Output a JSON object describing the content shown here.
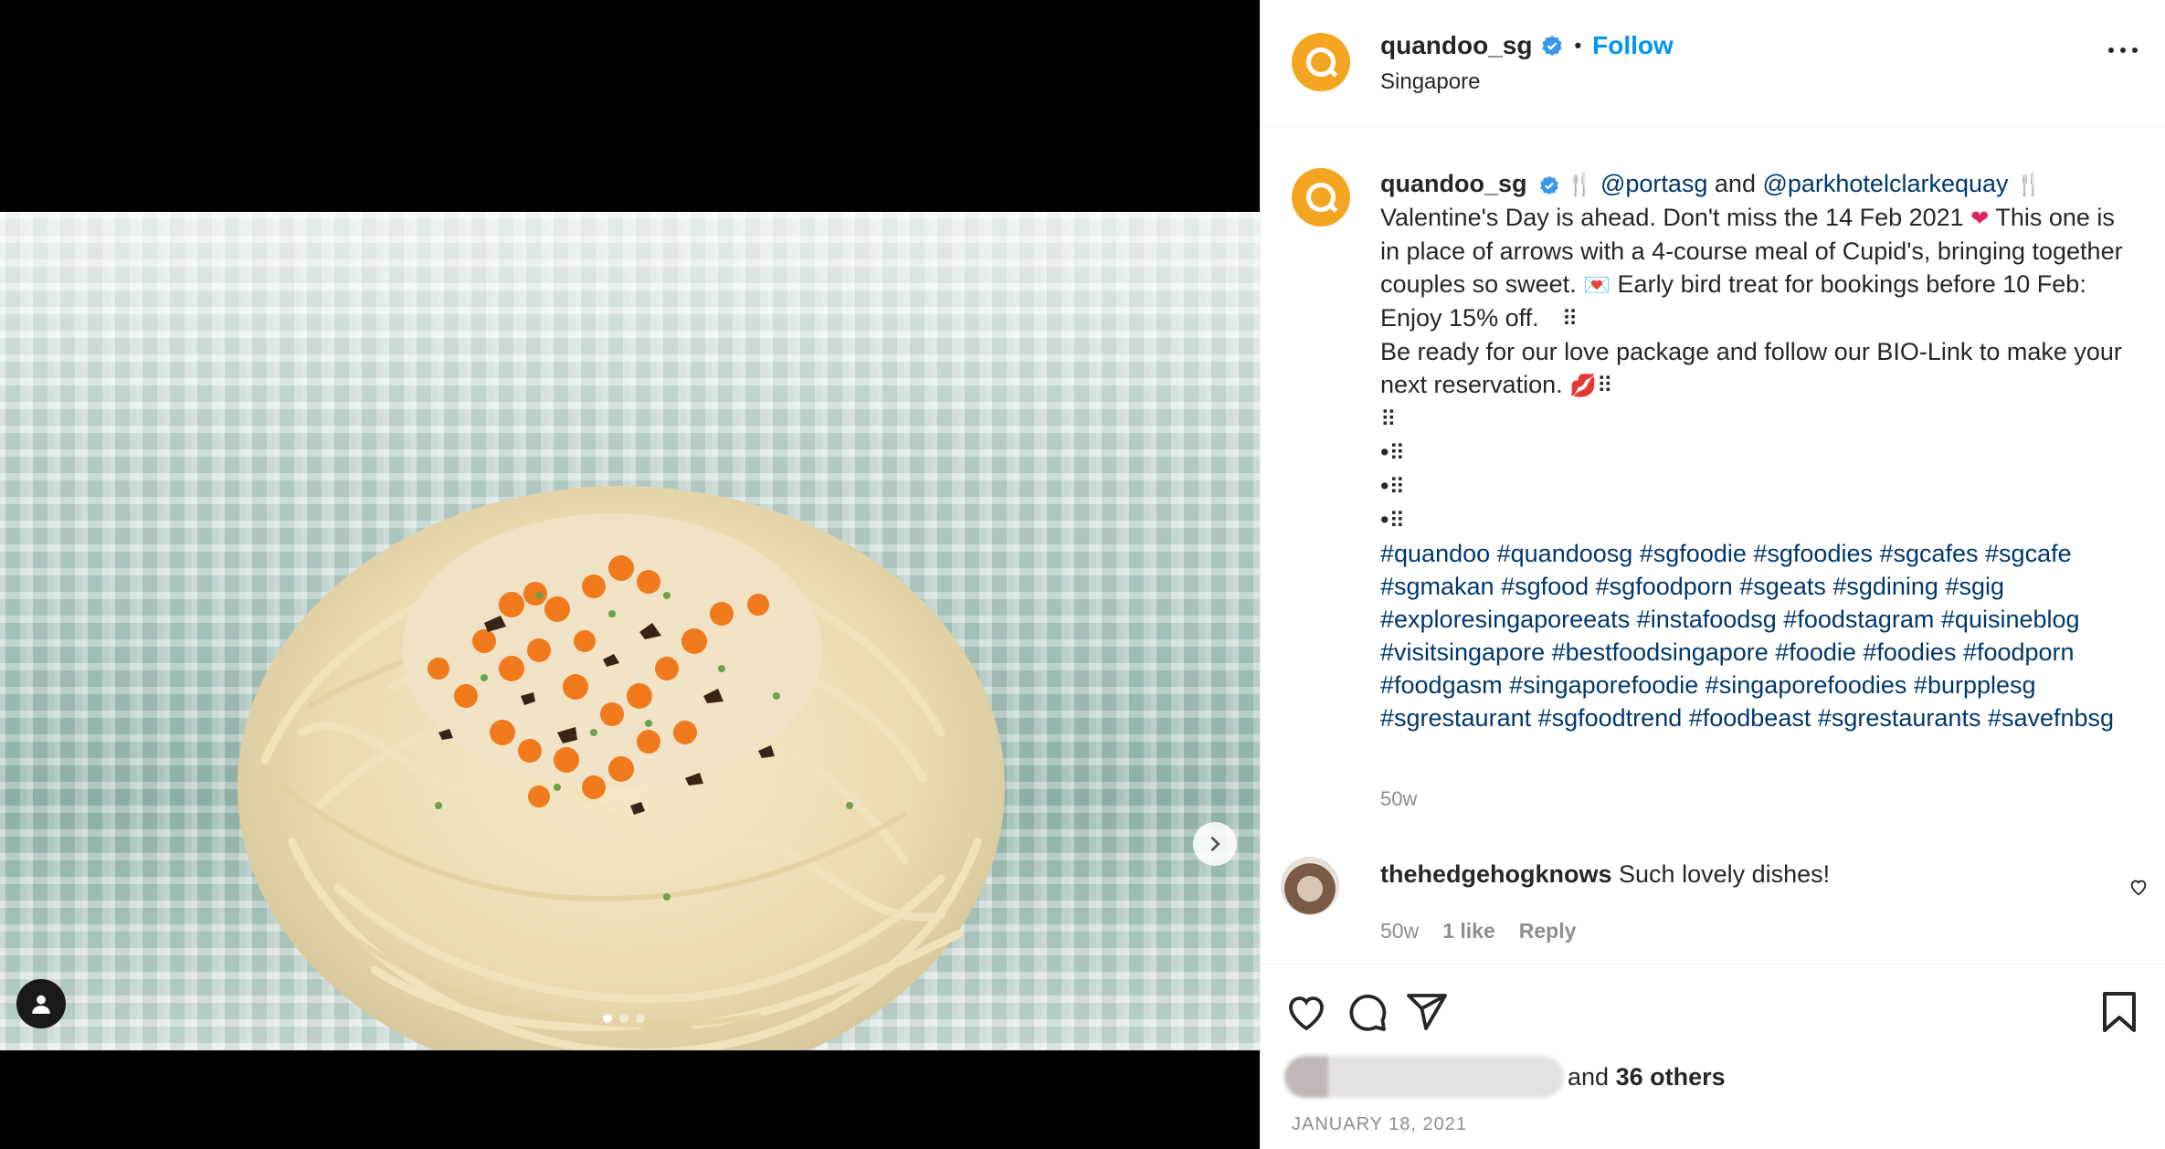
{
  "post": {
    "username": "quandoo_sg",
    "follow_label": "Follow",
    "separator": "•",
    "location": "Singapore"
  },
  "caption": {
    "username": "quandoo_sg",
    "line_mentions_1": "@portasg",
    "word_and": " and ",
    "line_mentions_2": "@parkhotelclarkequay",
    "p1": "Valentine's Day is ahead. Don't miss the 14 Feb 2021",
    "p2": "This one is in place of arrows with a 4-course meal of Cupid's, bringing together couples so sweet.",
    "p3": "Early bird treat for bookings before 10 Feb: Enjoy 15% off.",
    "p4": "Be ready for our love package and follow our BIO-Link to make your next reservation.",
    "bullet": "•",
    "hashtags": "#quandoo #quandoosg #sgfoodie #sgfoodies #sgcafes #sgcafe #sgmakan #sgfood #sgfoodporn #sgeats #sgdining #sgig #exploresingaporeeats #instafoodsg #foodstagram #quisineblog #visitsingapore #bestfoodsingapore #foodie #foodies #foodporn #foodgasm #singaporefoodie #singaporefoodies #burpplesg #sgrestaurant #sgfoodtrend #foodbeast #sgrestaurants #savefnbsg",
    "time": "50w"
  },
  "comment": {
    "username": "thehedgehogknows",
    "text": "Such lovely dishes!",
    "time": "50w",
    "likes": "1 like",
    "reply": "Reply"
  },
  "likes": {
    "and": "and",
    "others": "36 others"
  },
  "date": "JANUARY 18, 2021",
  "icons": [
    "verified-icon",
    "more-icon",
    "heart-icon",
    "comment-icon",
    "share-icon",
    "bookmark-icon",
    "chevron-right-icon",
    "user-tag-icon"
  ],
  "colors": {
    "brand": "#f4a623",
    "link": "#0095f6",
    "hashtag": "#00376b",
    "muted": "#8e8e8e"
  }
}
